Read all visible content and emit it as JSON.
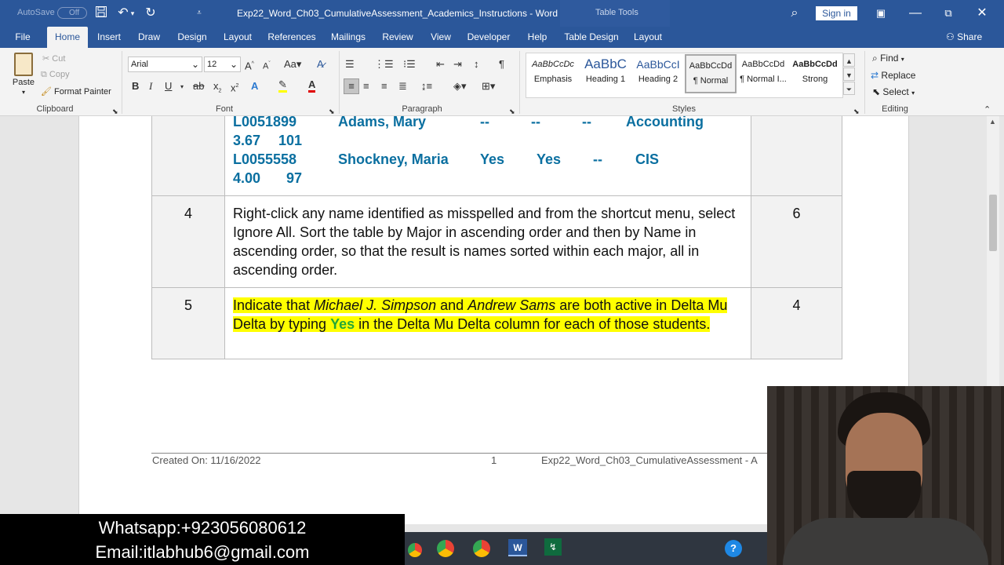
{
  "titlebar": {
    "autosave_label": "AutoSave",
    "autosave_state": "Off",
    "doc_title": "Exp22_Word_Ch03_CumulativeAssessment_Academics_Instructions - Word",
    "context_label": "Table Tools",
    "sign_in": "Sign in"
  },
  "tabs": [
    "File",
    "Home",
    "Insert",
    "Draw",
    "Design",
    "Layout",
    "References",
    "Mailings",
    "Review",
    "View",
    "Developer",
    "Help",
    "Table Design",
    "Layout"
  ],
  "share": "Share",
  "clipboard": {
    "paste": "Paste",
    "cut": "Cut",
    "copy": "Copy",
    "format_painter": "Format Painter",
    "group": "Clipboard"
  },
  "font": {
    "name": "Arial",
    "size": "12",
    "group": "Font"
  },
  "paragraph": {
    "group": "Paragraph"
  },
  "styles": {
    "group": "Styles",
    "items": [
      {
        "preview": "AaBbCcDc",
        "name": "Emphasis"
      },
      {
        "preview": "AaBbC",
        "name": "Heading 1"
      },
      {
        "preview": "AaBbCcI",
        "name": "Heading 2"
      },
      {
        "preview": "AaBbCcDd",
        "name": "¶ Normal"
      },
      {
        "preview": "AaBbCcDd",
        "name": "¶ Normal I..."
      },
      {
        "preview": "AaBbCcDd",
        "name": "Strong"
      }
    ]
  },
  "editing": {
    "find": "Find",
    "replace": "Replace",
    "select": "Select",
    "group": "Editing"
  },
  "document": {
    "row3": {
      "line1": [
        "L0051899",
        "Adams, Mary",
        "--",
        "--",
        "--",
        "Accounting"
      ],
      "line2": [
        "3.67",
        "101"
      ],
      "line3": [
        "L0055558",
        "Shockney, Maria",
        "Yes",
        "Yes",
        "--",
        "CIS"
      ],
      "line4": [
        "4.00",
        "97"
      ]
    },
    "row4": {
      "num": "4",
      "text": "Right-click any name identified as misspelled and from the shortcut menu, select Ignore All. Sort the table by Major in ascending order and then by Name in ascending order, so that the result is names sorted within each major, all in ascending order.",
      "points": "6"
    },
    "row5": {
      "num": "5",
      "t1": "Indicate that ",
      "t2": "Michael J. Simpson",
      "t3": " and ",
      "t4": "Andrew Sams",
      "t5": " are both active in Delta Mu Delta by typing ",
      "t6": "Yes",
      "t7": " in the Delta Mu Delta column for each of those students.",
      "points": "4"
    }
  },
  "footer": {
    "created": "Created On: 11/16/2022",
    "page": "1",
    "filename": "Exp22_Word_Ch03_CumulativeAssessment - A"
  },
  "overlay": {
    "whatsapp": "Whatsapp:+923056080612",
    "email": "Email:itlabhub6@gmail.com"
  }
}
